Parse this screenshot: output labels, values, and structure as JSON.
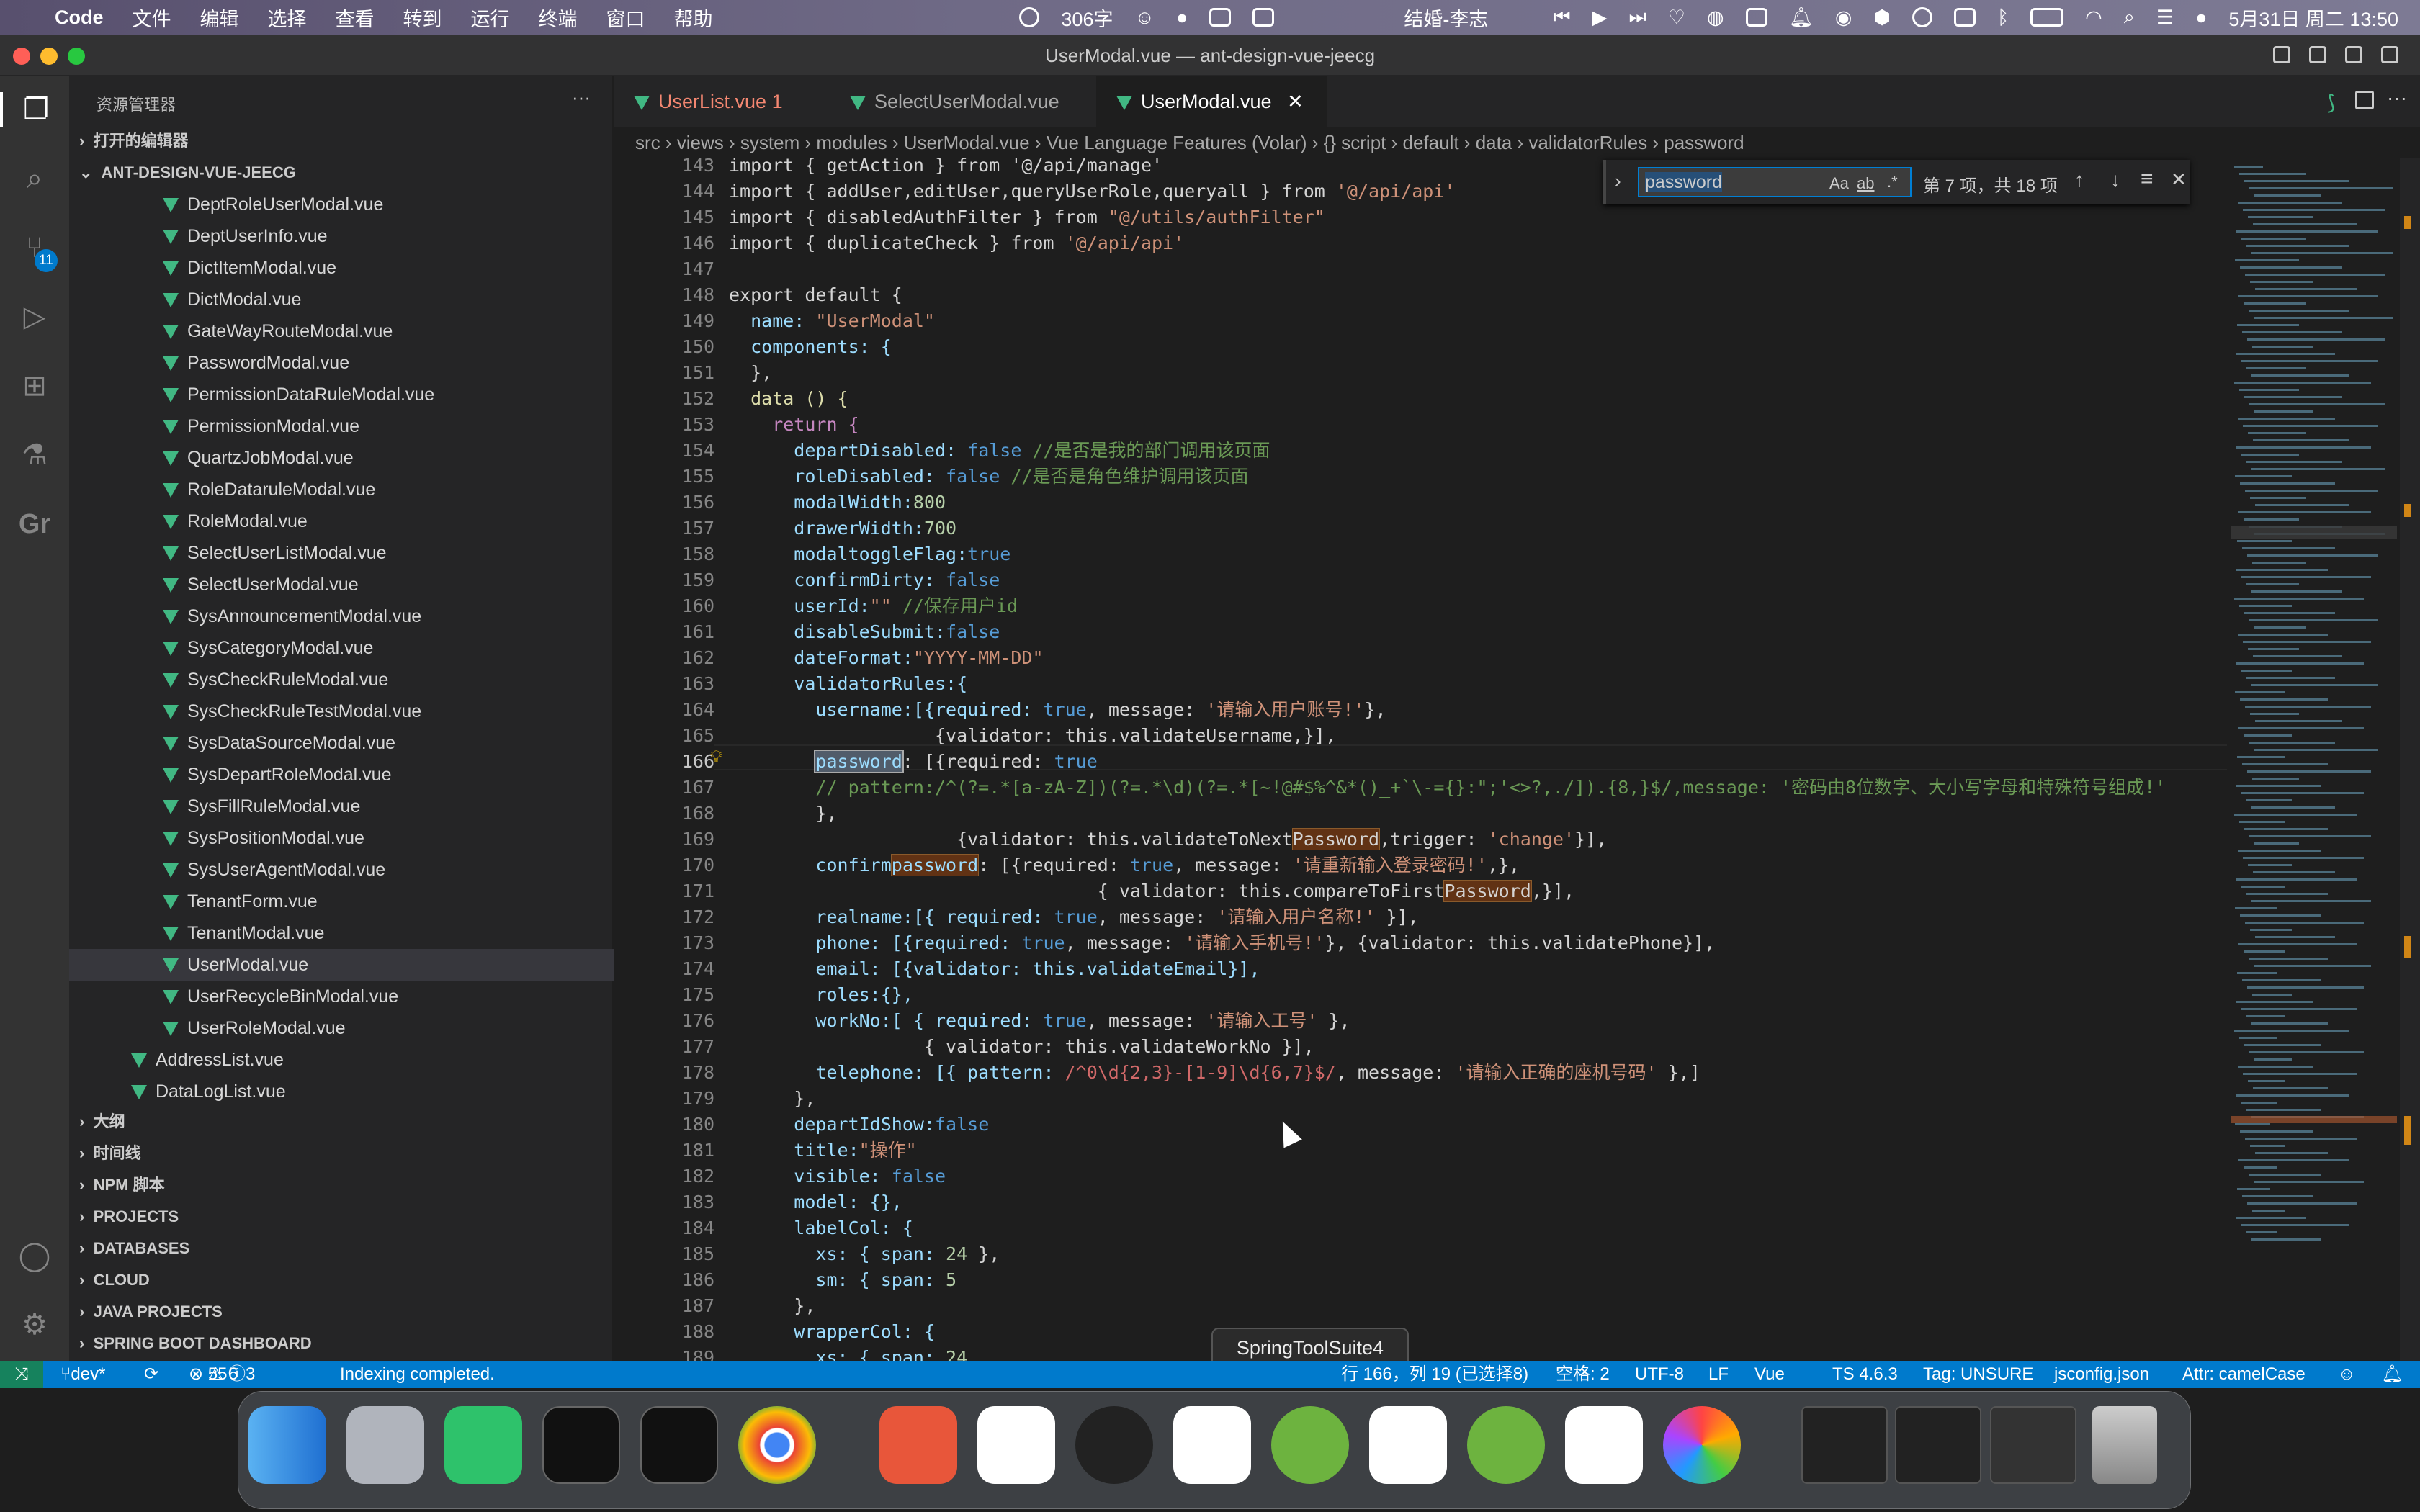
{
  "menubar": {
    "app": "Code",
    "items": [
      "文件",
      "编辑",
      "选择",
      "查看",
      "转到",
      "运行",
      "终端",
      "窗口",
      "帮助"
    ],
    "word_count": "306字",
    "song": "结婚-李志",
    "datetime": "5月31日 周二 13:50"
  },
  "window": {
    "title": "UserModal.vue — ant-design-vue-jeecg"
  },
  "activity": {
    "scm_badge": "11",
    "gr_label": "Gr"
  },
  "sidebar": {
    "header": "资源管理器",
    "more": "···",
    "open_editors": "打开的编辑器",
    "project": "ANT-DESIGN-VUE-JEECG",
    "files": [
      "DeptRoleUserModal.vue",
      "DeptUserInfo.vue",
      "DictItemModal.vue",
      "DictModal.vue",
      "GateWayRouteModal.vue",
      "PasswordModal.vue",
      "PermissionDataRuleModal.vue",
      "PermissionModal.vue",
      "QuartzJobModal.vue",
      "RoleDataruleModal.vue",
      "RoleModal.vue",
      "SelectUserListModal.vue",
      "SelectUserModal.vue",
      "SysAnnouncementModal.vue",
      "SysCategoryModal.vue",
      "SysCheckRuleModal.vue",
      "SysCheckRuleTestModal.vue",
      "SysDataSourceModal.vue",
      "SysDepartRoleModal.vue",
      "SysFillRuleModal.vue",
      "SysPositionModal.vue",
      "SysUserAgentModal.vue",
      "TenantForm.vue",
      "TenantModal.vue",
      "UserModal.vue",
      "UserRecycleBinModal.vue",
      "UserRoleModal.vue"
    ],
    "outer_files": [
      "AddressList.vue",
      "DataLogList.vue"
    ],
    "sections": [
      "大纲",
      "时间线",
      "NPM 脚本",
      "PROJECTS",
      "DATABASES",
      "CLOUD",
      "JAVA PROJECTS",
      "SPRING BOOT DASHBOARD"
    ]
  },
  "tabs": [
    {
      "label": "UserList.vue",
      "badge": "1"
    },
    {
      "label": "SelectUserModal.vue"
    },
    {
      "label": "UserModal.vue"
    }
  ],
  "breadcrumb": [
    "src",
    "views",
    "system",
    "modules",
    "UserModal.vue",
    "Vue Language Features (Volar)",
    "{} script",
    "default",
    "data",
    "validatorRules",
    "password"
  ],
  "find": {
    "query": "password",
    "result": "第 7 项，共 18 项",
    "opt_case": "Aa",
    "opt_word": "ab",
    "opt_regex": ".*"
  },
  "lines": [
    "143",
    "144",
    "145",
    "146",
    "147",
    "148",
    "149",
    "150",
    "151",
    "152",
    "153",
    "154",
    "155",
    "156",
    "157",
    "158",
    "159",
    "160",
    "161",
    "162",
    "163",
    "164",
    "165",
    "166",
    "167",
    "168",
    "169",
    "170",
    "171",
    "172",
    "173",
    "174",
    "175",
    "176",
    "177",
    "178",
    "179",
    "180",
    "181",
    "182",
    "183",
    "184",
    "185",
    "186",
    "187",
    "188",
    "189"
  ],
  "code": {
    "l143": "import { getAction } from '@/api/manage'",
    "l144a": "import { addUser,editUser,queryUserRole,queryall } from ",
    "l144b": "'@/api/api'",
    "l145a": "import { disabledAuthFilter } from ",
    "l145b": "\"@/utils/authFilter\"",
    "l146a": "import { duplicateCheck } from ",
    "l146b": "'@/api/api'",
    "l148": "export default {",
    "l149a": "  name: ",
    "l149b": "\"UserModal\"",
    "l150": "  components: {",
    "l151": "  },",
    "l152": "  data () {",
    "l153": "    return {",
    "l154a": "      departDisabled: ",
    "l154b": "false",
    "l154c": " //是否是我的部门调用该页面",
    "l155a": "      roleDisabled: ",
    "l155b": "false",
    "l155c": " //是否是角色维护调用该页面",
    "l156a": "      modalWidth:",
    "l156b": "800",
    "l157a": "      drawerWidth:",
    "l157b": "700",
    "l158a": "      modaltoggleFlag:",
    "l158b": "true",
    "l159a": "      confirmDirty: ",
    "l159b": "false",
    "l160a": "      userId:",
    "l160b": "\"\"",
    "l160c": " //保存用户id",
    "l161a": "      disableSubmit:",
    "l161b": "false",
    "l162a": "      dateFormat:",
    "l162b": "\"YYYY-MM-DD\"",
    "l163": "      validatorRules:{",
    "l164a": "        username:[{required: ",
    "l164b": "true",
    "l164c": ", message: ",
    "l164d": "'请输入用户账号!'",
    "l164e": "},",
    "l165": "                   {validator: this.validateUsername,}],",
    "l166a": "        ",
    "l166b": "password",
    "l166c": ": [{required: ",
    "l166d": "true",
    "l167": "        // pattern:/^(?=.*[a-zA-Z])(?=.*\\d)(?=.*[~!@#$%^&*()_+`\\-={}:\";'<>?,./]).{8,}$/,message: '密码由8位数字、大小写字母和特殊符号组成!'",
    "l168": "        },",
    "l169a": "                     {validator: this.validateToNext",
    "l169b": "Password",
    "l169c": ",trigger: ",
    "l169d": "'change'",
    "l169e": "}],",
    "l170a": "        confirm",
    "l170b": "password",
    "l170c": ": [{required: ",
    "l170d": "true",
    "l170e": ", message: ",
    "l170f": "'请重新输入登录密码!'",
    "l170g": ",},",
    "l171a": "                                  { validator: this.compareToFirst",
    "l171b": "Password",
    "l171c": ",}],",
    "l172a": "        realname:[{ required: ",
    "l172b": "true",
    "l172c": ", message: ",
    "l172d": "'请输入用户名称!'",
    "l172e": " }],",
    "l173a": "        phone: [{required: ",
    "l173b": "true",
    "l173c": ", message: ",
    "l173d": "'请输入手机号!'",
    "l173e": "}, {validator: this.validatePhone}],",
    "l174": "        email: [{validator: this.validateEmail}],",
    "l175": "        roles:{},",
    "l176a": "        workNo:[ { required: ",
    "l176b": "true",
    "l176c": ", message: ",
    "l176d": "'请输入工号'",
    "l176e": " },",
    "l177": "                  { validator: this.validateWorkNo }],",
    "l178a": "        telephone: [{ pattern: ",
    "l178b": "/^0\\d{2,3}-[1-9]\\d{6,7}$/",
    "l178c": ", message: ",
    "l178d": "'请输入正确的座机号码'",
    "l178e": " },]",
    "l179": "      },",
    "l180a": "      departIdShow:",
    "l180b": "false",
    "l181a": "      title:",
    "l181b": "\"操作\"",
    "l182a": "      visible: ",
    "l182b": "false",
    "l183": "      model: {},",
    "l184": "      labelCol: {",
    "l185a": "        xs: { span: ",
    "l185b": "24",
    " l185c": " },",
    "l186a": "        sm: { span: ",
    "l186b": "5",
    "l187": "      },",
    "l188": "      wrapperCol: {",
    "l189a": "        xs: { span: ",
    "l189b": "24"
  },
  "tooltip": "SpringToolSuite4",
  "status": {
    "branch": "dev*",
    "errors": "55",
    "warnings": "6",
    "info": "3",
    "message": "Indexing completed.",
    "position": "行 166，列 19 (已选择8)",
    "spaces": "空格: 2",
    "encoding": "UTF-8",
    "eol": "LF",
    "lang": "Vue",
    "ts": "TS 4.6.3",
    "tag": "Tag: UNSURE",
    "config": "jsconfig.json",
    "attr": "Attr: camelCase"
  },
  "colors": {
    "accent": "#007acc",
    "vue": "#41b883",
    "keyword": "#c586c0",
    "string": "#ce9178",
    "property": "#9cdcfe",
    "boolean": "#569cd6",
    "number": "#b5cea8",
    "comment": "#6a9955"
  }
}
